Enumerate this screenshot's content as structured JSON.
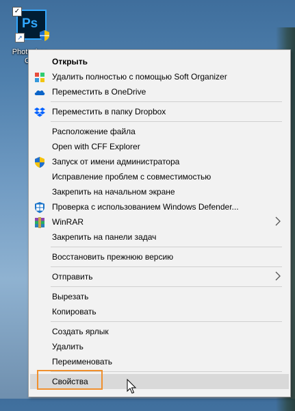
{
  "desktop": {
    "icon_label_line1": "Photoshop",
    "icon_label_line2": "CC"
  },
  "menu": {
    "items": [
      {
        "label": "Открыть",
        "icon": "none"
      },
      {
        "label": "Удалить полностью с помощью Soft Organizer",
        "icon": "soft-organizer-icon"
      },
      {
        "label": "Переместить в OneDrive",
        "icon": "onedrive-icon"
      },
      {
        "label": "Переместить в папку Dropbox",
        "icon": "dropbox-icon"
      },
      {
        "label": "Расположение файла",
        "icon": "none"
      },
      {
        "label": "Open with CFF Explorer",
        "icon": "none"
      },
      {
        "label": "Запуск от имени администратора",
        "icon": "uac-shield-icon"
      },
      {
        "label": "Исправление проблем с совместимостью",
        "icon": "none"
      },
      {
        "label": "Закрепить на начальном экране",
        "icon": "none"
      },
      {
        "label": "Проверка с использованием Windows Defender...",
        "icon": "windows-defender-icon"
      },
      {
        "label": "WinRAR",
        "icon": "winrar-icon"
      },
      {
        "label": "Закрепить на панели задач",
        "icon": "none"
      },
      {
        "label": "Восстановить прежнюю версию",
        "icon": "none"
      },
      {
        "label": "Отправить",
        "icon": "none"
      },
      {
        "label": "Вырезать",
        "icon": "none"
      },
      {
        "label": "Копировать",
        "icon": "none"
      },
      {
        "label": "Создать ярлык",
        "icon": "none"
      },
      {
        "label": "Удалить",
        "icon": "none"
      },
      {
        "label": "Переименовать",
        "icon": "none"
      },
      {
        "label": "Свойства",
        "icon": "none"
      }
    ]
  },
  "colors": {
    "highlight_border": "#f0902d",
    "menu_background": "#f2f2f2",
    "hover_background": "#d9d9d9"
  }
}
